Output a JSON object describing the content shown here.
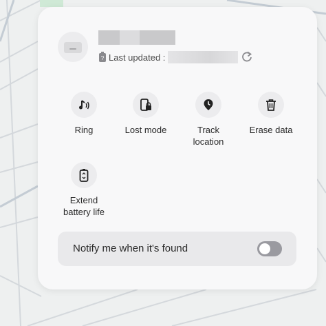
{
  "device": {
    "last_updated_label": "Last updated :"
  },
  "actions": [
    {
      "label": "Ring",
      "icon": "music-note-icon"
    },
    {
      "label": "Lost mode",
      "icon": "lock-phone-icon"
    },
    {
      "label": "Track\nlocation",
      "icon": "location-pin-icon"
    },
    {
      "label": "Erase data",
      "icon": "trash-icon"
    },
    {
      "label": "Extend\nbattery life",
      "icon": "battery-saver-icon"
    }
  ],
  "notify": {
    "label": "Notify me when it's found",
    "enabled": false
  },
  "colors": {
    "panel": "#f8f8f9",
    "icon_circle": "#ececee",
    "toggle_off": "#9a9aa0"
  }
}
